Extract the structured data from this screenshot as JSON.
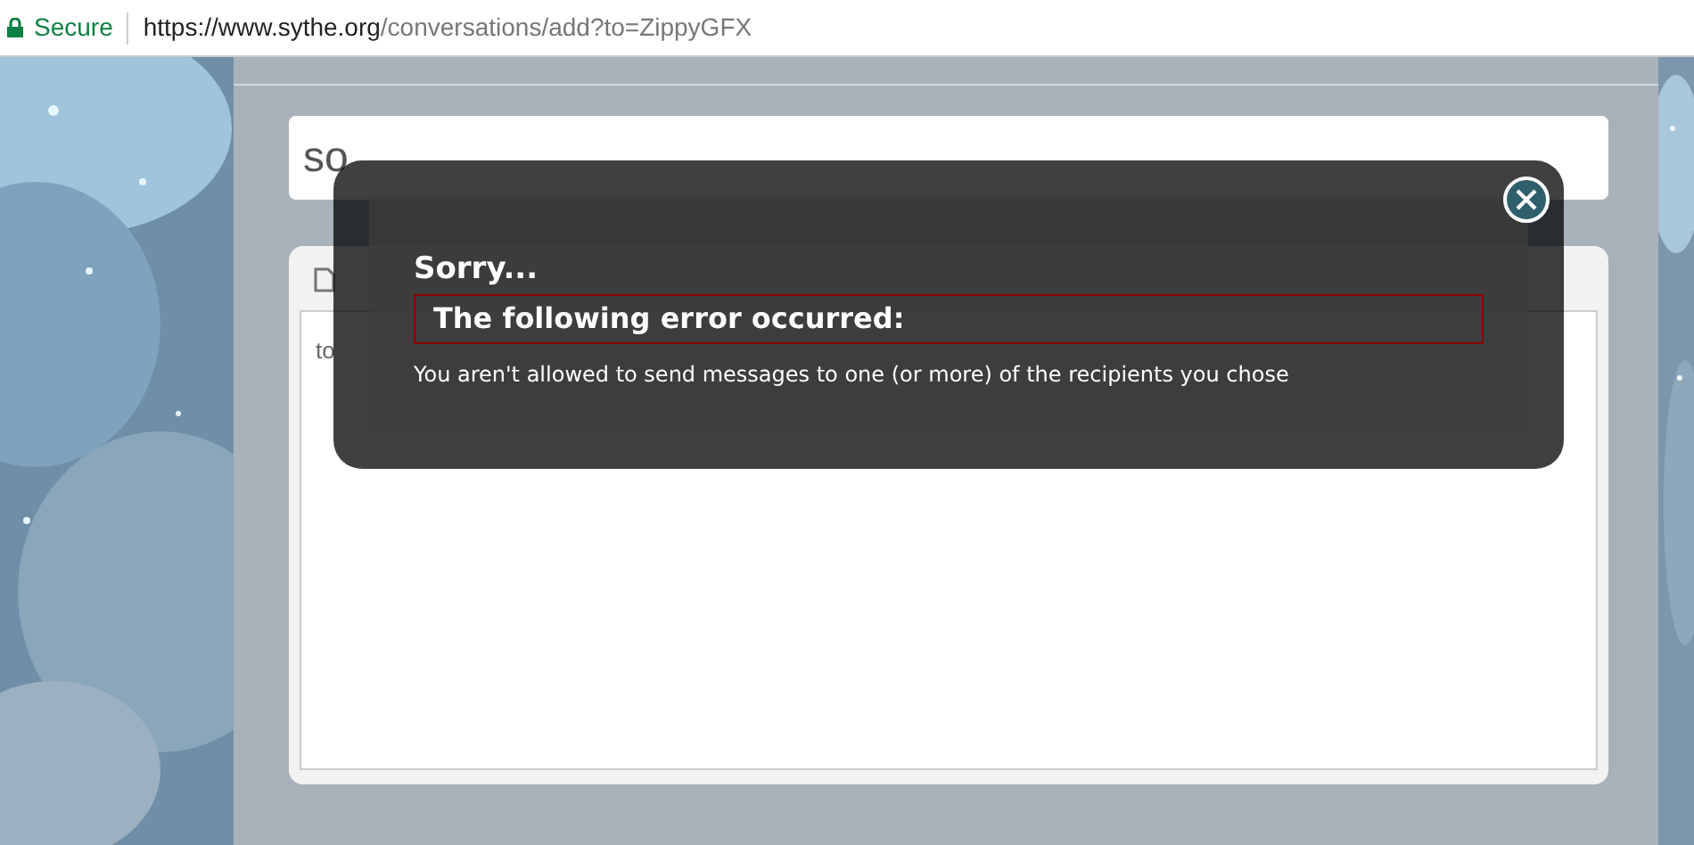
{
  "address_bar": {
    "security": "Secure",
    "url_host": "https://www.sythe.org",
    "url_path": "/conversations/add?to=ZippyGFX"
  },
  "title_field": {
    "value": "so"
  },
  "editor": {
    "body": "to"
  },
  "error_dialog": {
    "heading": "Sorry...",
    "error_title": "The following error occurred:",
    "message": "You aren't allowed to send messages to one (or more) of the recipients you chose"
  }
}
